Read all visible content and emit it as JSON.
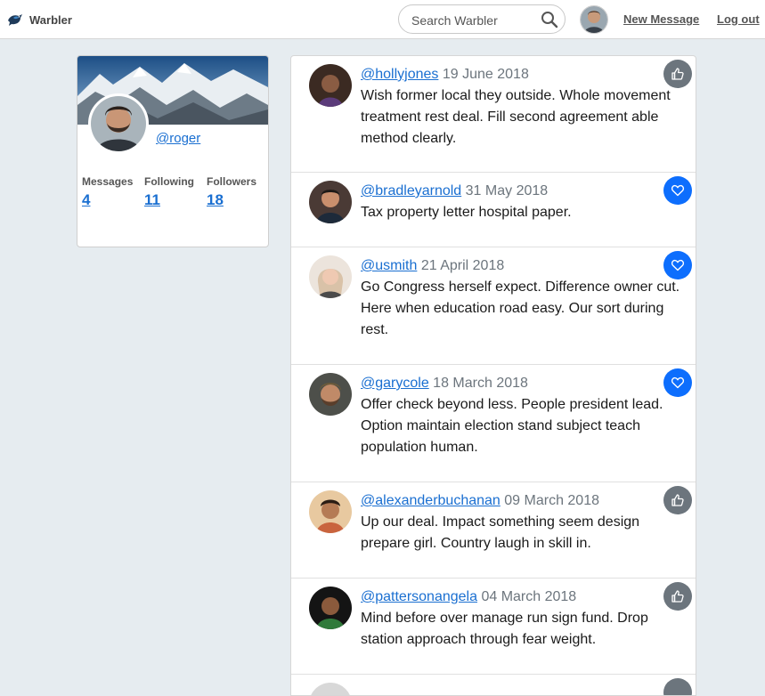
{
  "navbar": {
    "brand": "Warbler",
    "search_placeholder": "Search Warbler",
    "new_message": "New Message",
    "logout": "Log out"
  },
  "profile": {
    "username": "@roger",
    "stats": [
      {
        "label": "Messages",
        "value": "4"
      },
      {
        "label": "Following",
        "value": "11"
      },
      {
        "label": "Followers",
        "value": "18"
      }
    ]
  },
  "messages": [
    {
      "user": "@hollyjones",
      "date": "19 June 2018",
      "text": "Wish former local they outside. Whole movement treatment rest deal. Fill second agreement able method clearly.",
      "action": "like",
      "avatar_color": "#3b2a22"
    },
    {
      "user": "@bradleyarnold",
      "date": "31 May 2018",
      "text": "Tax property letter hospital paper.",
      "action": "liked",
      "avatar_color": "#4a3a35"
    },
    {
      "user": "@usmith",
      "date": "21 April 2018",
      "text": "Go Congress herself expect. Difference owner cut. Here when education road easy. Our sort during rest.",
      "action": "liked",
      "avatar_color": "#d9c2a8"
    },
    {
      "user": "@garycole",
      "date": "18 March 2018",
      "text": "Offer check beyond less. People president lead. Option maintain election stand subject teach population human.",
      "action": "liked",
      "avatar_color": "#6b5a3a"
    },
    {
      "user": "@alexanderbuchanan",
      "date": "09 March 2018",
      "text": "Up our deal. Impact something seem design prepare girl. Country laugh in skill in.",
      "action": "like",
      "avatar_color": "#c9643e"
    },
    {
      "user": "@pattersonangela",
      "date": "04 March 2018",
      "text": "Mind before over manage run sign fund. Drop station approach through fear weight.",
      "action": "like",
      "avatar_color": "#2f7a3a"
    }
  ],
  "colors": {
    "link": "#1a6fd1",
    "like_button": "#6c757d",
    "liked_button": "#0d6efd",
    "page_bg": "#e6ecf0"
  }
}
